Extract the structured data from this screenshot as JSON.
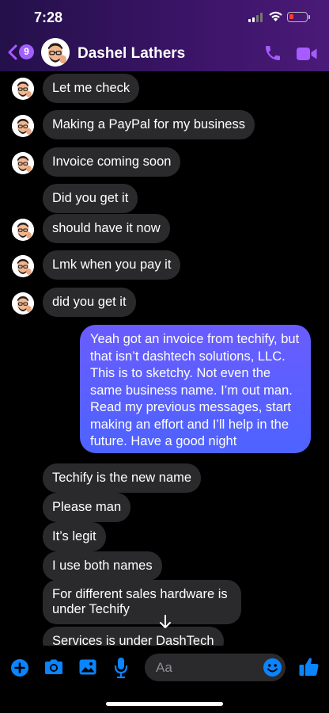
{
  "status_bar": {
    "time": "7:28"
  },
  "header": {
    "back_badge": "9",
    "contact_name": "Dashel Lathers"
  },
  "messages": [
    {
      "text": "Let me check"
    },
    {
      "text": "Making a PayPal for my business"
    },
    {
      "text": "Invoice coming soon"
    },
    {
      "text": "Did you get it"
    },
    {
      "text": "should have it now"
    },
    {
      "text": "Lmk when you pay it"
    },
    {
      "text": "did you get it"
    },
    {
      "text": "Yeah got an invoice from techify, but that isn’t dashtech solutions, LLC. This is to sketchy. Not even the same business name. I’m out man. Read my previous messages, start making an effort and I’ll help in the future. Have a good night"
    },
    {
      "text": "Techify is the new name"
    },
    {
      "text": "Please man"
    },
    {
      "text": "It’s legit"
    },
    {
      "text": "I use both names"
    },
    {
      "text": "For different sales hardware is under Techify"
    },
    {
      "text": "Services is under DashTech"
    }
  ],
  "composer": {
    "placeholder": "Aa"
  },
  "colors": {
    "accent": "#0a84ff",
    "header_purple": "#a65cff",
    "received_bubble": "#2a2a2c",
    "sent_bubble": "#5b5fff"
  }
}
